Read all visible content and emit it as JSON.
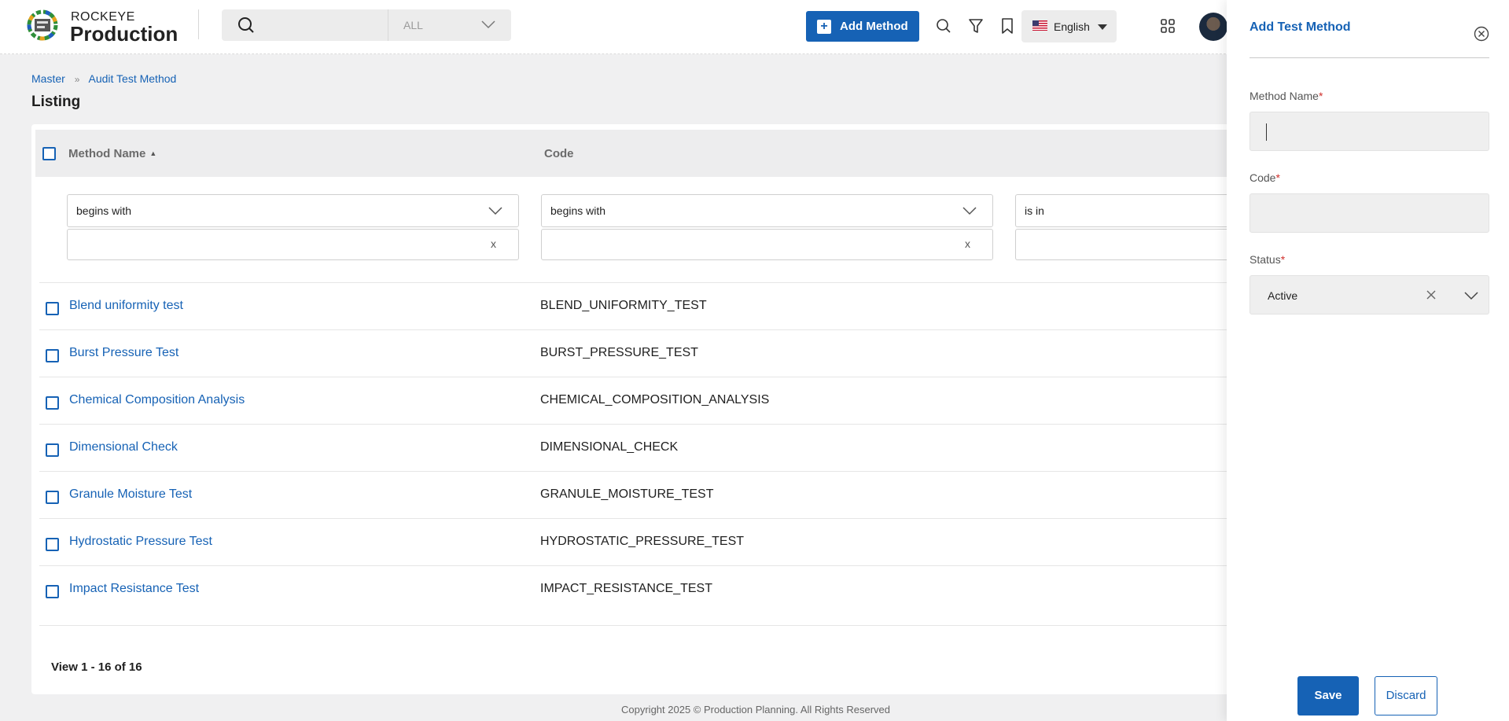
{
  "header": {
    "brand_top": "ROCKEYE",
    "brand_main": "Production",
    "search_scope": "ALL",
    "add_button": "Add Method",
    "language": "English"
  },
  "breadcrumb": {
    "items": [
      "Master",
      "Audit Test Method"
    ]
  },
  "page_title": "Listing",
  "table": {
    "columns": [
      "Method Name",
      "Code"
    ],
    "filters": {
      "name_operator": "begins with",
      "code_operator": "begins with",
      "status_operator": "is in",
      "clear_symbol": "x"
    },
    "rows": [
      {
        "name": "Blend uniformity test",
        "code": "BLEND_UNIFORMITY_TEST"
      },
      {
        "name": "Burst Pressure Test",
        "code": "BURST_PRESSURE_TEST"
      },
      {
        "name": "Chemical Composition Analysis",
        "code": "CHEMICAL_COMPOSITION_ANALYSIS"
      },
      {
        "name": "Dimensional Check",
        "code": "DIMENSIONAL_CHECK"
      },
      {
        "name": "Granule Moisture Test",
        "code": "GRANULE_MOISTURE_TEST"
      },
      {
        "name": "Hydrostatic Pressure Test",
        "code": "HYDROSTATIC_PRESSURE_TEST"
      },
      {
        "name": "Impact Resistance Test",
        "code": "IMPACT_RESISTANCE_TEST"
      }
    ]
  },
  "pager": "View 1 - 16 of 16",
  "footer": "Copyright 2025 © Production Planning. All Rights Reserved",
  "panel": {
    "title": "Add Test Method",
    "method_name_label": "Method Name",
    "code_label": "Code",
    "status_label": "Status",
    "required_mark": "*",
    "status_value": "Active",
    "save_label": "Save",
    "discard_label": "Discard"
  },
  "colors": {
    "primary": "#1662b5",
    "required": "#d0302c",
    "background": "#f0f0f1"
  }
}
